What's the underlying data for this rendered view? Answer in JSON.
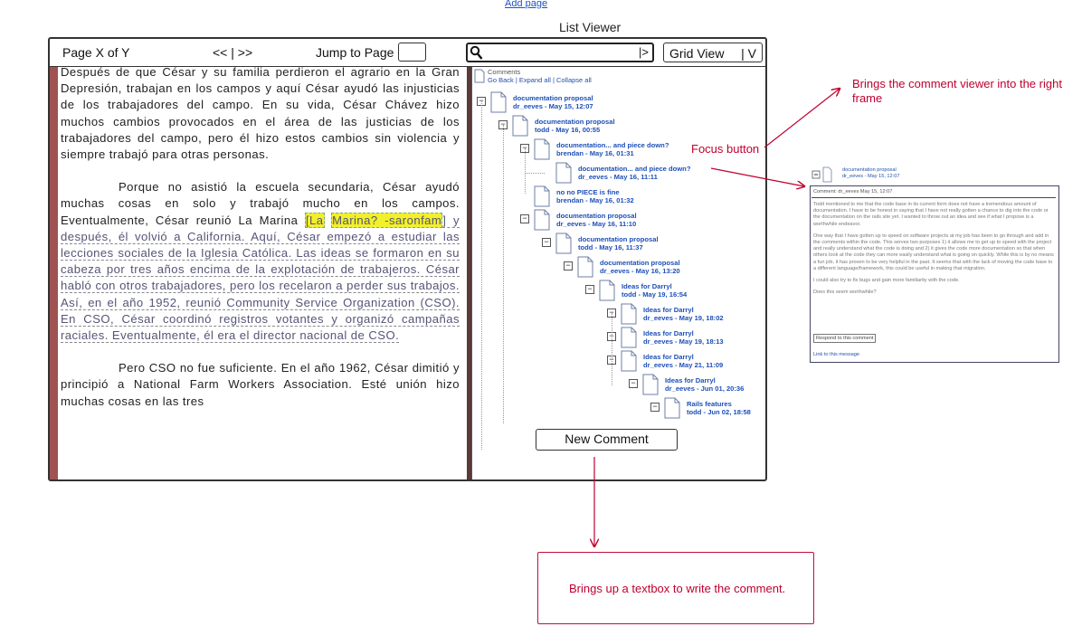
{
  "header": {
    "add_page": "Add page",
    "title": "List Viewer"
  },
  "toolbar": {
    "page_indicator": "Page X of Y",
    "pager": "<< | >>",
    "jump_label": "Jump to Page",
    "search_go": "|>",
    "grid_view_label": "Grid View",
    "grid_view_caret": "| V"
  },
  "document": {
    "p1": "Después de que César y su familia perdieron el agrario en la Gran Depresión, trabajan en los campos y aquí César ayudó las injusticias de los trabajadores del campo. En su vida, César Chávez hizo muchos cambios provocados en el área de las justicias de los trabajadores del campo, pero él hizo estos cambios sin violencia y siempre trabajó para otras personas.",
    "p2_a": "Porque no asistió la escuela secundaria, César ayudó muchas cosas en solo y trabajó mucho en los campos. Eventualmente, César reunió La Marina ",
    "p2_hl1": "[La",
    "p2_hl2": "Marina? -saronfam",
    "p2_b": "] y después, él volvió a California. Aquí, César empezó a estudiar las lecciones sociales de la Iglesia Católica. Las ideas se formaron en su cabeza por tres años encima de la explotación de trabajeros. César habló con otros trabajadores, pero los recelaron a perder sus trabajos. Así, en el año 1952, reunió Community Service Organization (CSO). En CSO, César coordinó registros votantes y organizó campañas raciales. Eventualmente, él era el director nacional de CSO.",
    "p3": "Pero CSO no fue suficiente. En el año 1962, César dimitió y principió a National Farm Workers Association. Esté unión hizo muchas cosas en las tres"
  },
  "comments": {
    "title": "Comments",
    "links": "Go Back | Expand all | Collapse all",
    "items": [
      {
        "title": "documentation proposal",
        "meta": "dr_eeves - May 15, 12:07"
      },
      {
        "title": "documentation proposal",
        "meta": "todd - May 16, 00:55"
      },
      {
        "title": "documentation... and piece down?",
        "meta": "brendan - May 16, 01:31"
      },
      {
        "title": "documentation... and piece down?",
        "meta": "dr_eeves - May 16, 11:11"
      },
      {
        "title": "no no PIECE is fine",
        "meta": "brendan - May 16, 01:32"
      },
      {
        "title": "documentation proposal",
        "meta": "dr_eeves - May 16, 11:10"
      },
      {
        "title": "documentation proposal",
        "meta": "todd - May 16, 11:37"
      },
      {
        "title": "documentation proposal",
        "meta": "dr_eeves - May 16, 13:20"
      },
      {
        "title": "Ideas for Darryl",
        "meta": "todd - May 19, 16:54"
      },
      {
        "title": "Ideas for Darryl",
        "meta": "dr_eeves - May 19, 18:02"
      },
      {
        "title": "Ideas for Darryl",
        "meta": "dr_eeves - May 19, 18:13"
      },
      {
        "title": "Ideas for Darryl",
        "meta": "dr_eeves - May 21, 11:09"
      },
      {
        "title": "Ideas for Darryl",
        "meta": "dr_eeves - Jun 01, 20:36"
      },
      {
        "title": "Rails features",
        "meta": "todd - Jun 02, 18:58"
      }
    ],
    "new_comment": "New Comment"
  },
  "annotations": {
    "focus": "Focus button",
    "right_frame": "Brings the comment viewer into the right frame",
    "textbox": "Brings up a textbox to write the comment."
  },
  "preview": {
    "node_title": "documentation proposal",
    "node_meta": "dr_eeves - May 15, 12:07",
    "header": "Comment: dr_eeves    May 15, 12:07",
    "para1": "Todd mentioned to me that the code base in its current form does not have a tremendous amount of documentation. I have to be honest in saying that I have not really gotten a chance to dig into the code or the documentation on the rails site yet. I wanted to throw out an idea and see if what I propose is a worthwhile endeavor.",
    "para2": "One way that I have gotten up to speed on software projects at my job has been to go through and add in the comments within the code. This serves two purposes 1) it allows me to get up to speed with the project and really understand what the code is doing and 2) it gives the code more documentation so that when others look at the code they can more easily understand what is going on quickly. While this is by no means a fun job, it has proven to be very helpful in the past. It seems that with the lack of moving the code base to a different language/framework, this could be useful in making that migration.",
    "para3": "I could also try to fix bugs and gain more familiarity with the code.",
    "para4": "Does this seem worthwhile?",
    "respond": "Respond to this comment",
    "link": "Link to this message"
  },
  "colors": {
    "annotation": "#c0002e",
    "link": "#1d4fb8",
    "margin_bar": "#a05252"
  }
}
